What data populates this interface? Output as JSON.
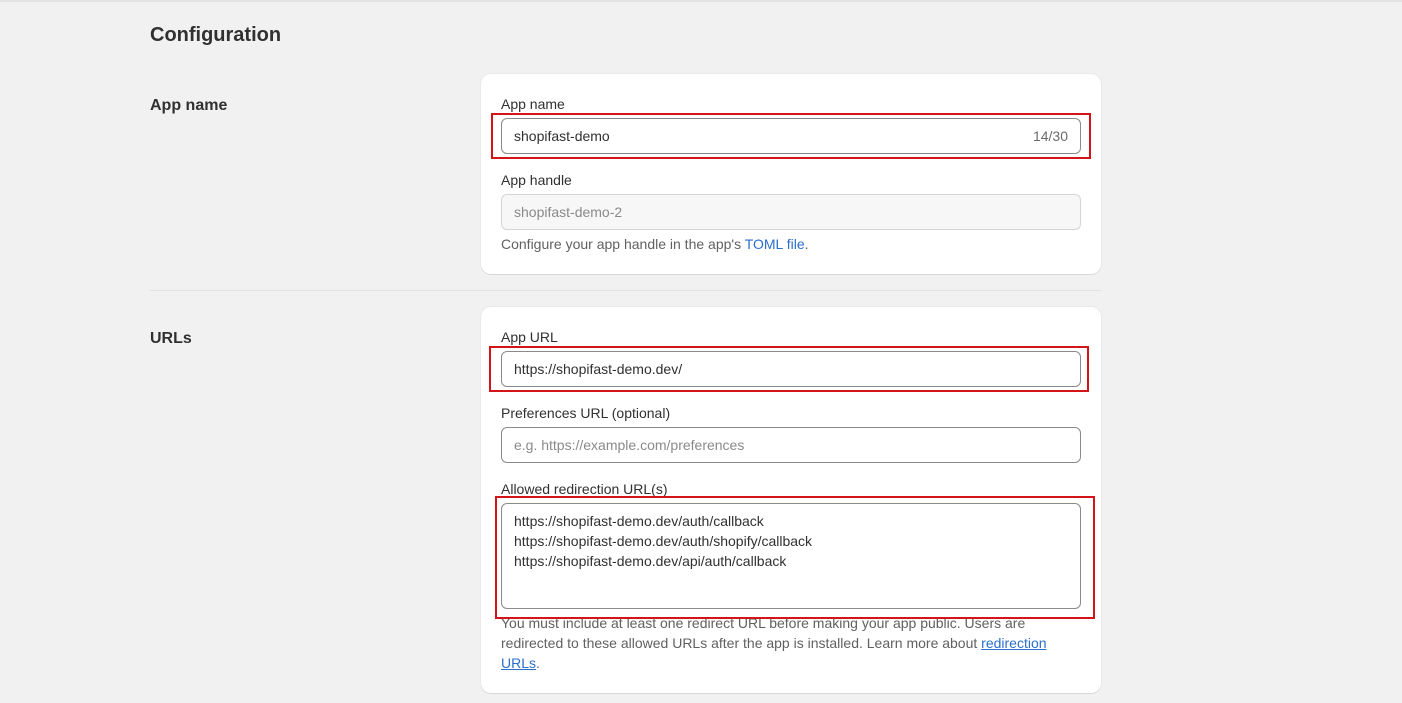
{
  "page": {
    "title": "Configuration"
  },
  "app_name_section": {
    "title": "App name",
    "app_name": {
      "label": "App name",
      "value": "shopifast-demo",
      "counter": "14/30"
    },
    "app_handle": {
      "label": "App handle",
      "value": "shopifast-demo-2",
      "help_prefix": "Configure your app handle in the app's ",
      "help_link": "TOML file",
      "help_suffix": "."
    }
  },
  "urls_section": {
    "title": "URLs",
    "app_url": {
      "label": "App URL",
      "value": "https://shopifast-demo.dev/"
    },
    "preferences_url": {
      "label": "Preferences URL (optional)",
      "placeholder": "e.g. https://example.com/preferences"
    },
    "redirect_urls": {
      "label": "Allowed redirection URL(s)",
      "values": [
        "https://shopifast-demo.dev/auth/callback",
        "https://shopifast-demo.dev/auth/shopify/callback",
        "https://shopifast-demo.dev/api/auth/callback"
      ],
      "help_text": "You must include at least one redirect URL before making your app public. Users are redirected to these allowed URLs after the app is installed. Learn more about ",
      "help_link": "redirection URLs",
      "help_suffix": "."
    }
  },
  "colors": {
    "highlight": "#d3151a",
    "link": "#2c6ecb"
  }
}
